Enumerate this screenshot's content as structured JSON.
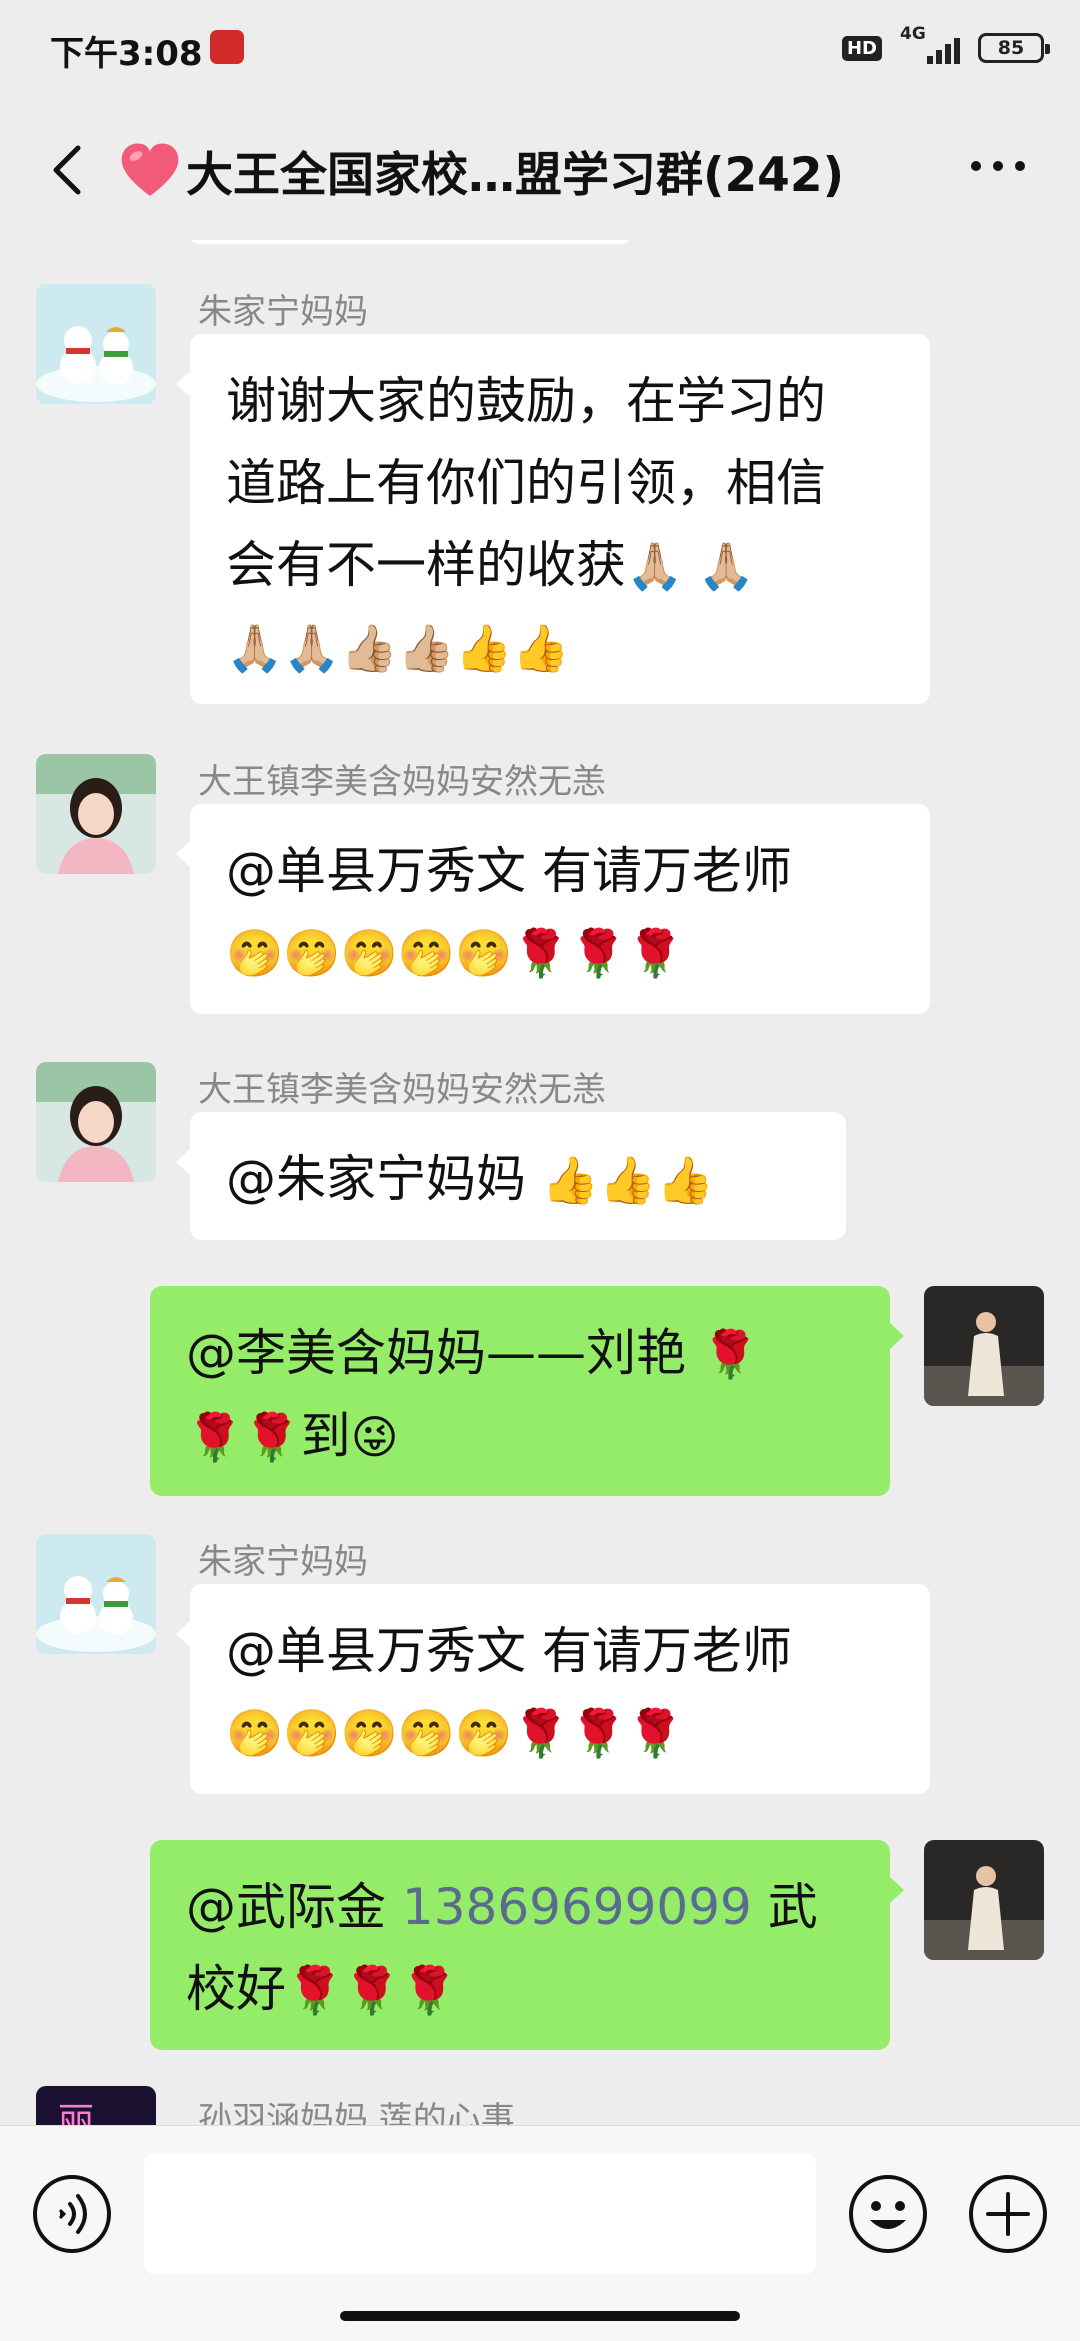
{
  "status": {
    "time": "下午3:08",
    "hd": "HD",
    "network": "4G",
    "battery": "85"
  },
  "header": {
    "title": "大王全国家校…盟学习群(242)"
  },
  "messages": [
    {
      "side": "left",
      "sender": "朱家宁妈妈",
      "avatar": "snowman-avatar",
      "lines": [
        "谢谢大家的鼓励，在学习的",
        "道路上有你们的引领，相信",
        "会有不一样的收获"
      ],
      "emoji_line3": "🙏🏼 🙏🏼",
      "emoji_line4": "🙏🏼🙏🏼👍🏼👍🏼👍👍"
    },
    {
      "side": "left",
      "sender": "大王镇李美含妈妈安然无恙",
      "avatar": "girl-avatar",
      "text": "@单县万秀文  有请万老师",
      "emoji": "🤭🤭🤭🤭🤭🌹🌹🌹"
    },
    {
      "side": "left",
      "sender": "大王镇李美含妈妈安然无恙",
      "avatar": "girl-avatar",
      "text": "@朱家宁妈妈 ",
      "emoji": "👍👍👍"
    },
    {
      "side": "right",
      "avatar": "woman-avatar",
      "text1": "@李美含妈妈——刘艳 ",
      "emoji1": "🌹",
      "emoji2": "🌹🌹",
      "text2": "到",
      "emoji3": "😜"
    },
    {
      "side": "left",
      "sender": "朱家宁妈妈",
      "avatar": "snowman-avatar",
      "text": "@单县万秀文  有请万老师",
      "emoji": "🤭🤭🤭🤭🤭🌹🌹🌹"
    },
    {
      "side": "right",
      "avatar": "woman-avatar",
      "text1": "@武际金 ",
      "phone": "13869699099",
      "text2": " 武",
      "text3": "校好",
      "emoji": "🌹🌹🌹"
    },
    {
      "side": "left",
      "sender": "孙羽涵妈妈  莲的心事",
      "avatar": "li-avatar",
      "avatar_text": "丽"
    }
  ],
  "colors": {
    "green_bubble": "#95ec69",
    "white_bubble": "#ffffff",
    "background": "#ededed",
    "link": "#5b6a90"
  }
}
